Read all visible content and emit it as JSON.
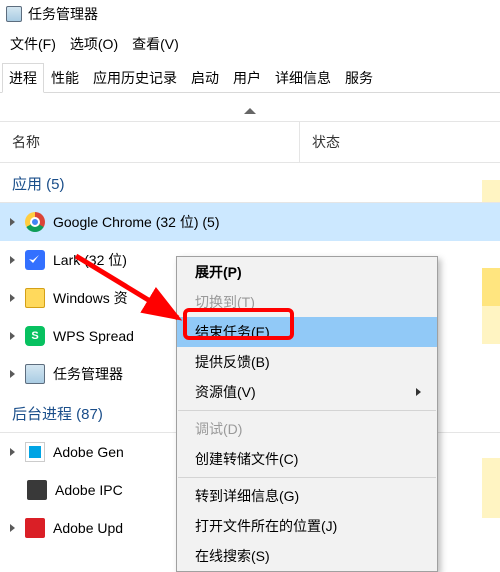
{
  "window": {
    "title": "任务管理器"
  },
  "menubar": [
    "文件(F)",
    "选项(O)",
    "查看(V)"
  ],
  "tabs": [
    "进程",
    "性能",
    "应用历史记录",
    "启动",
    "用户",
    "详细信息",
    "服务"
  ],
  "active_tab": 0,
  "columns": {
    "name": "名称",
    "status": "状态"
  },
  "groups": {
    "apps": "应用 (5)",
    "bg": "后台进程 (87)"
  },
  "rows": [
    {
      "label": "Google Chrome (32 位) (5)",
      "icon": "chrome"
    },
    {
      "label": "Lark (32 位)",
      "icon": "lark"
    },
    {
      "label": "Windows 资",
      "icon": "explorer"
    },
    {
      "label": "WPS Spread",
      "icon": "wps"
    },
    {
      "label": "任务管理器",
      "icon": "taskmgr"
    }
  ],
  "bg_rows": [
    {
      "label": "Adobe Gen",
      "icon": "adobe1"
    },
    {
      "label": "Adobe IPC",
      "icon": "adobe2"
    },
    {
      "label": "Adobe Upd",
      "icon": "adobe3"
    }
  ],
  "context_menu": {
    "expand": "展开(P)",
    "switch_to": "切换到(T)",
    "end_task": "结束任务(E)",
    "feedback": "提供反馈(B)",
    "resources": "资源值(V)",
    "debug": "调试(D)",
    "dump": "创建转储文件(C)",
    "details": "转到详细信息(G)",
    "open_location": "打开文件所在的位置(J)",
    "search_online": "在线搜索(S)"
  }
}
